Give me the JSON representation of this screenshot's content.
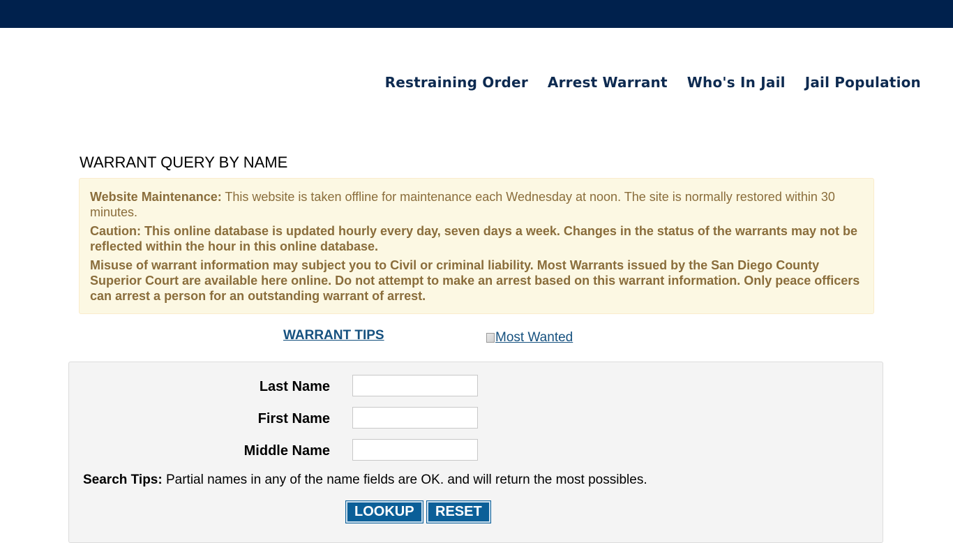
{
  "nav": {
    "items": [
      "Restraining Order",
      "Arrest Warrant",
      "Who's In Jail",
      "Jail Population"
    ]
  },
  "page_title": "WARRANT QUERY BY NAME",
  "notice": {
    "maintenance_label": "Website Maintenance:",
    "maintenance_text": " This website is taken offline for maintenance each Wednesday at noon. The site is normally restored within 30 minutes.",
    "caution_text": "Caution: This online database is updated hourly every day, seven days a week. Changes in the status of the warrants may not be reflected within the hour in this online database.",
    "misuse_text": "Misuse of warrant information may subject you to Civil or criminal liability. Most Warrants issued by the San Diego County Superior Court are available here online. Do not attempt to make an arrest based on this warrant information. Only peace officers can arrest a person for an outstanding warrant of arrest."
  },
  "links": {
    "warrant_tips": "WARRANT TIPS",
    "most_wanted_alt": "Most Wanted"
  },
  "form": {
    "last_name_label": "Last Name",
    "first_name_label": "First Name",
    "middle_name_label": "Middle Name",
    "last_name_value": "",
    "first_name_value": "",
    "middle_name_value": "",
    "search_tips_label": "Search Tips:",
    "search_tips_text": " Partial names in any of the name fields are OK. and will return the most possibles.",
    "lookup_label": "LOOKUP",
    "reset_label": "RESET"
  },
  "colors": {
    "top_bar": "#00214d",
    "nav_text": "#0d2a50",
    "notice_bg": "#fcf8e3",
    "notice_text": "#8a6d3b",
    "link": "#16517f",
    "button_bg": "#0b5f98"
  }
}
